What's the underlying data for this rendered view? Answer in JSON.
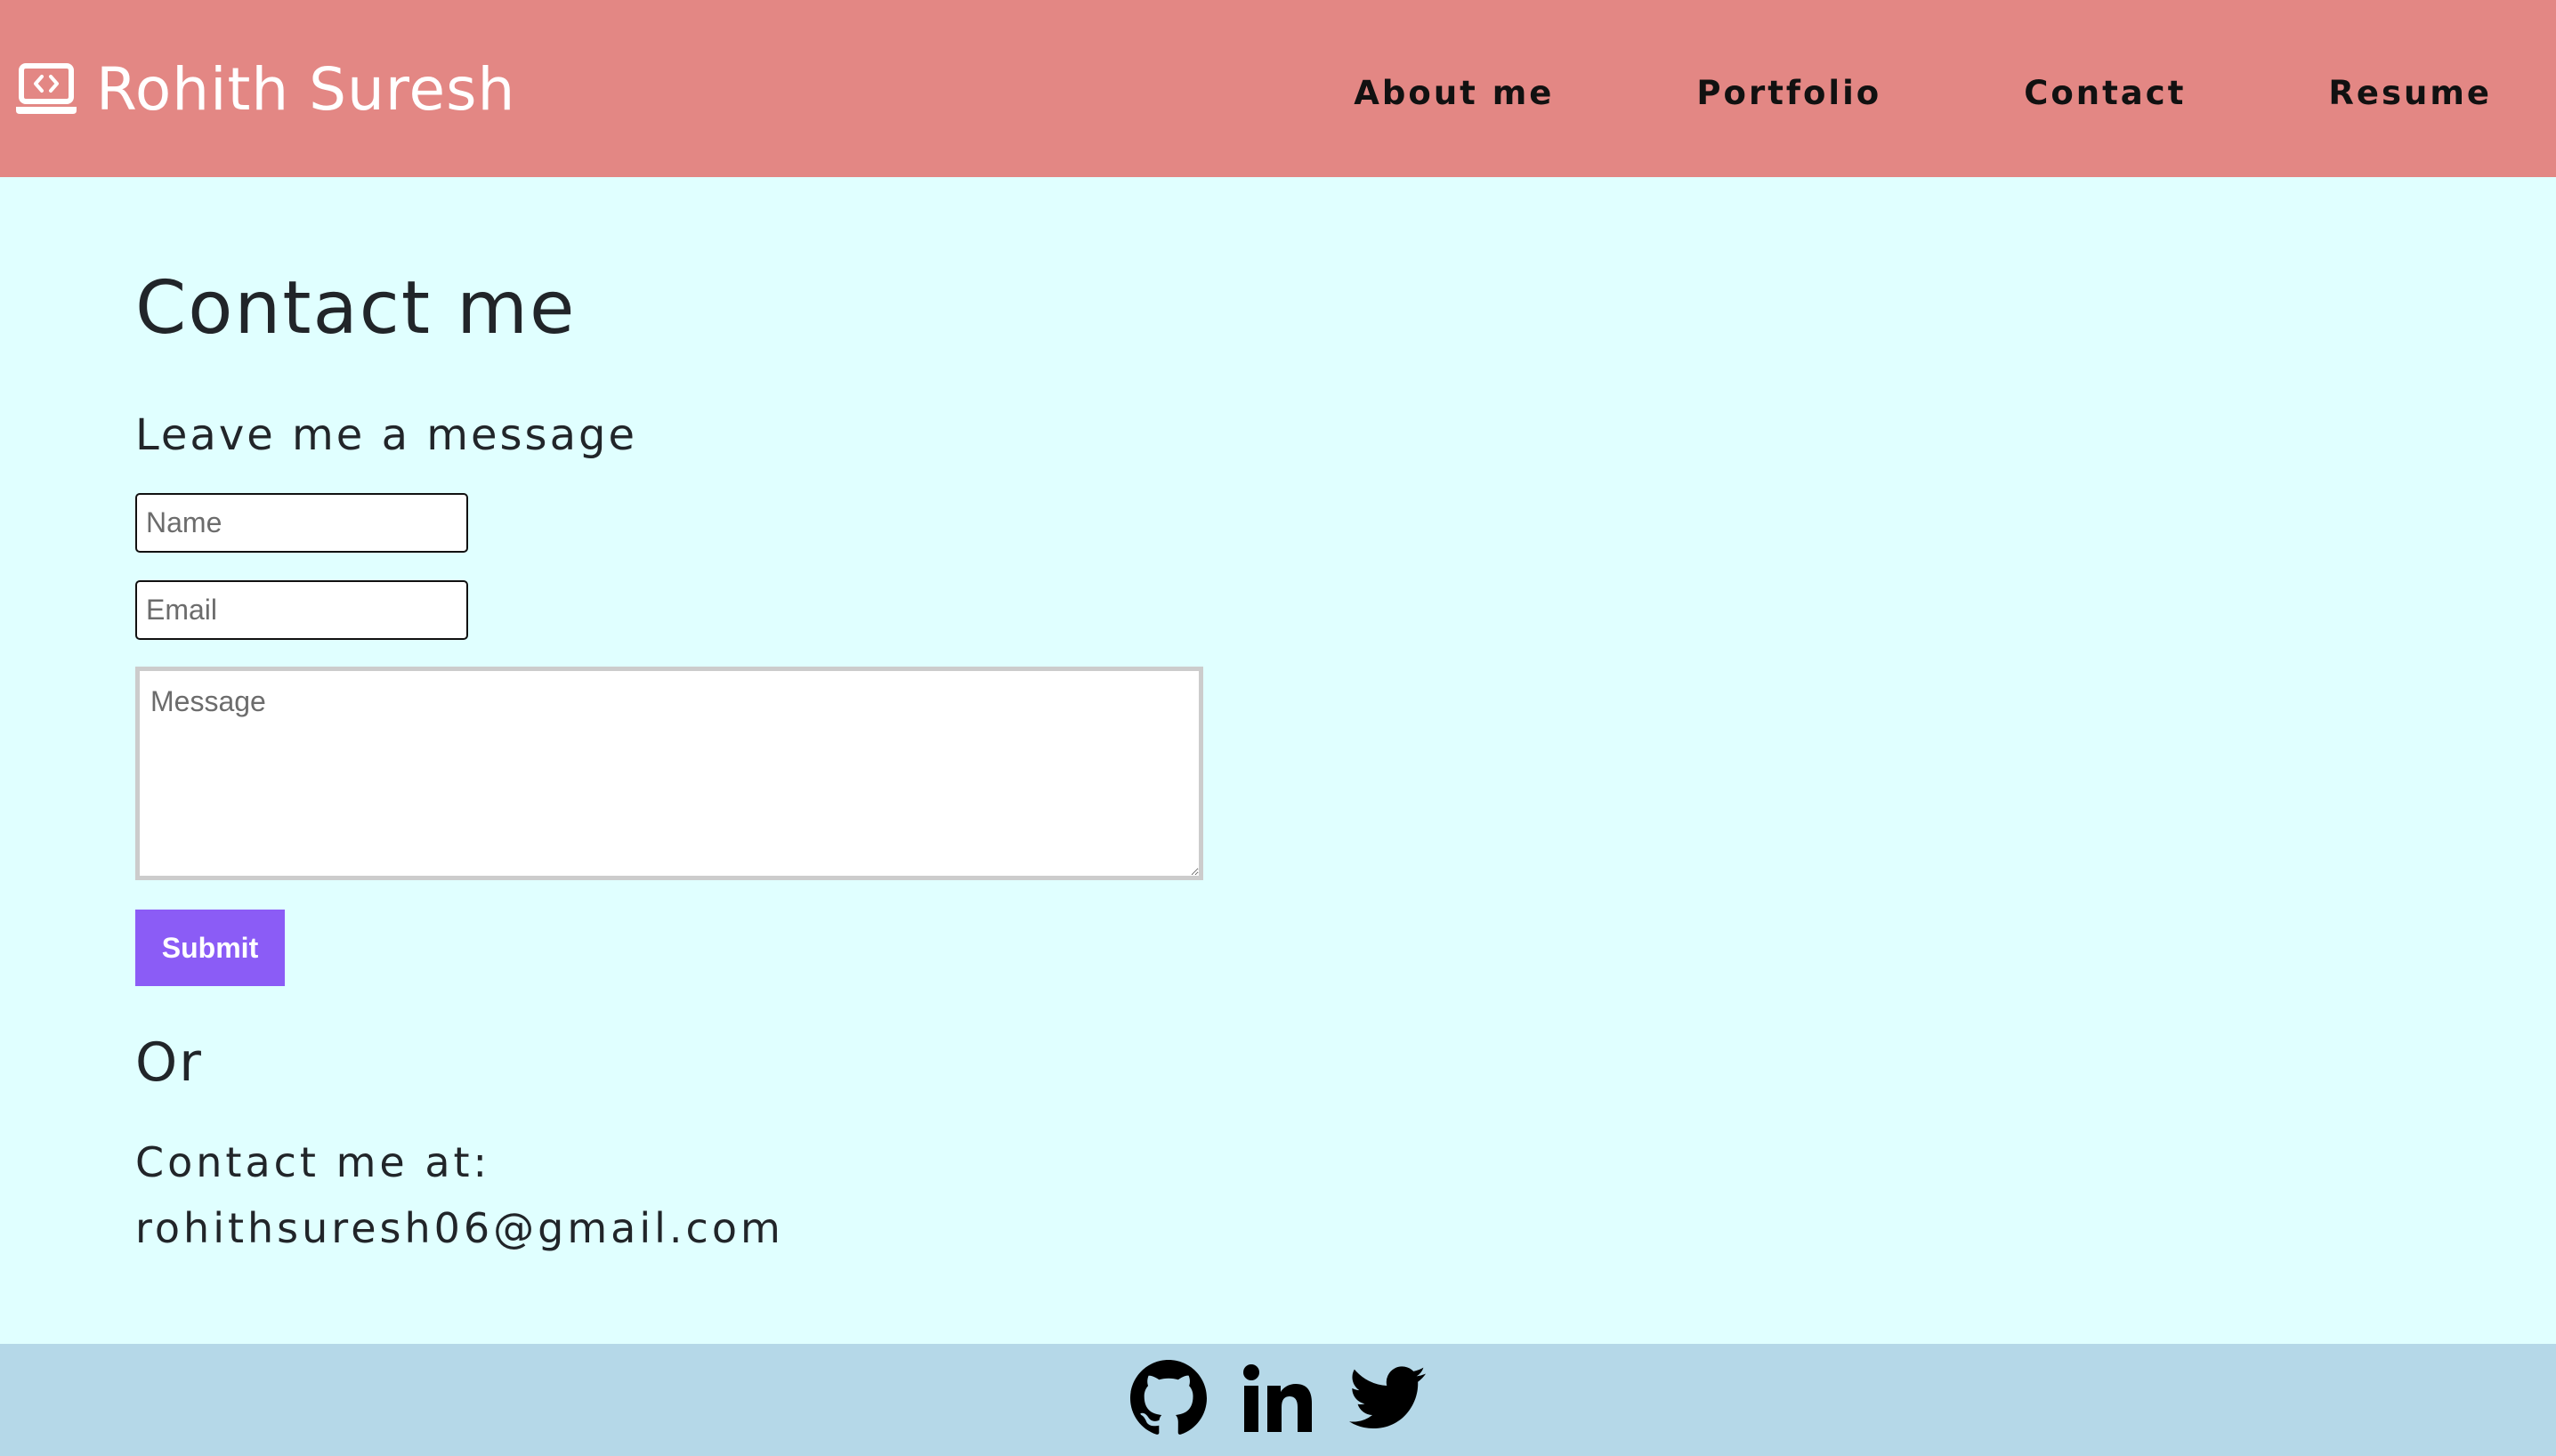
{
  "header": {
    "brand_name": "Rohith Suresh",
    "brand_icon": "laptop-code-icon",
    "background_color": "#e38784",
    "nav": [
      {
        "label": "About me"
      },
      {
        "label": "Portfolio"
      },
      {
        "label": "Contact"
      },
      {
        "label": "Resume"
      }
    ]
  },
  "main": {
    "background_color": "#e0ffff",
    "title": "Contact me",
    "subtitle": "Leave me a message",
    "form": {
      "name_placeholder": "Name",
      "email_placeholder": "Email",
      "message_placeholder": "Message",
      "submit_label": "Submit",
      "submit_color": "#8b5cf6"
    },
    "or_text": "Or",
    "contact_label": "Contact me at:",
    "contact_email": "rohithsuresh06@gmail.com"
  },
  "footer": {
    "background_color": "#b5d8e8",
    "social_icons": [
      "github-icon",
      "linkedin-icon",
      "twitter-icon"
    ]
  }
}
